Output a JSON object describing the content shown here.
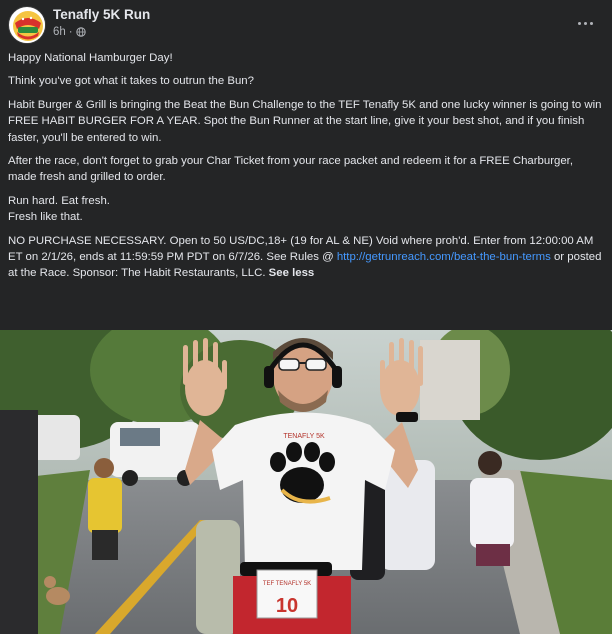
{
  "post": {
    "page_name": "Tenafly 5K Run",
    "time": "6h",
    "separator": "·",
    "avatar_icon": "tenafly-5k-logo-icon",
    "privacy_icon": "globe-icon",
    "more_icon": "more-options-icon",
    "paragraphs": {
      "p1": "Happy National Hamburger Day!",
      "p2": "Think you've got what it takes to outrun the Bun?",
      "p3": "Habit Burger & Grill is bringing the Beat the Bun Challenge to the TEF Tenafly 5K and one lucky winner is going to win FREE HABIT BURGER FOR A YEAR. Spot the Bun Runner at the start line, give it your best shot, and if you finish faster, you'll be entered to win.",
      "p4": "After the race, don't forget to grab your Char Ticket from your race packet and redeem it for a FREE Charburger, made fresh and grilled to order.",
      "p5a": "Run hard. Eat fresh.",
      "p5b": "Fresh like that.",
      "p6_start": "NO PURCHASE NECESSARY. Open to 50 US/DC,18+ (19 for AL & NE) Void where proh'd. Enter from 12:00:00 AM ET on 2/1/26, ends at 11:59:59 PM PDT on 6/7/26. See Rules @ ",
      "p6_link": "http://getrunreach.com/beat-the-bun-terms",
      "p6_end": " or posted at the Race. Sponsor: The Habit Restaurants, LLC. ",
      "see_less": "See less"
    },
    "photo": {
      "bib_number": "10",
      "bib_label": "TEF TENAFLY 5K",
      "shirt_text": "TENAFLY 5K"
    }
  },
  "colors": {
    "background": "#242526",
    "text": "#e4e6eb",
    "secondary_text": "#b0b3b8",
    "link": "#4599ff"
  }
}
